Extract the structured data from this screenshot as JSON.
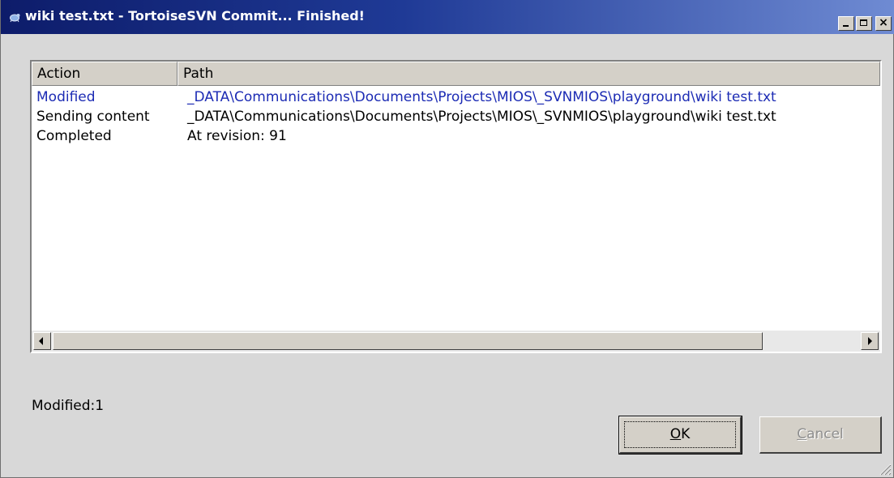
{
  "window": {
    "title": "wiki test.txt - TortoiseSVN Commit... Finished!"
  },
  "list": {
    "columns": {
      "action": "Action",
      "path": "Path"
    },
    "rows": [
      {
        "action": "Modified",
        "path": "_DATA\\Communications\\Documents\\Projects\\MIOS\\_SVNMIOS\\playground\\wiki test.txt"
      },
      {
        "action": "Sending content",
        "path": "_DATA\\Communications\\Documents\\Projects\\MIOS\\_SVNMIOS\\playground\\wiki test.txt"
      },
      {
        "action": "Completed",
        "path": "At revision: 91"
      }
    ]
  },
  "status": {
    "text": "Modified:1"
  },
  "buttons": {
    "ok_mnemonic": "O",
    "ok_rest": "K",
    "cancel_mnemonic": "C",
    "cancel_rest": "ancel"
  },
  "colors": {
    "modified_row": "#1c2bb4",
    "title_gradient_start": "#0d1c6a",
    "title_gradient_end": "#6f8bd3"
  },
  "icons": {
    "title": "tortoisesvn-icon",
    "minimize": "minimize-icon",
    "maximize": "maximize-icon",
    "close": "close-icon",
    "scroll_left": "arrow-left-icon",
    "scroll_right": "arrow-right-icon",
    "grip": "resize-grip-icon"
  }
}
